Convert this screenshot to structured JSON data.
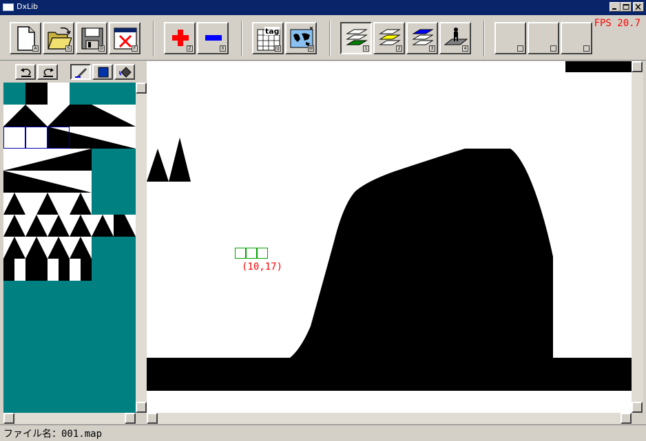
{
  "window": {
    "title": "DxLib"
  },
  "fps": "FPS 20.7",
  "toolbar": {
    "keys": {
      "new": "A",
      "open": "S",
      "save": "D",
      "close": "F",
      "add": "Z",
      "remove": "X",
      "tag": "Q",
      "map": "W",
      "layer1": "1",
      "layer2": "2",
      "layer3": "3",
      "layer4": "4"
    },
    "tag_label": "tag"
  },
  "layers": {
    "layer1": "#008000",
    "layer2": "#ffff00",
    "layer3": "#0000ff"
  },
  "cursor": {
    "coord": "(10,17)"
  },
  "status": {
    "filename": "ファイル名：001.map"
  }
}
